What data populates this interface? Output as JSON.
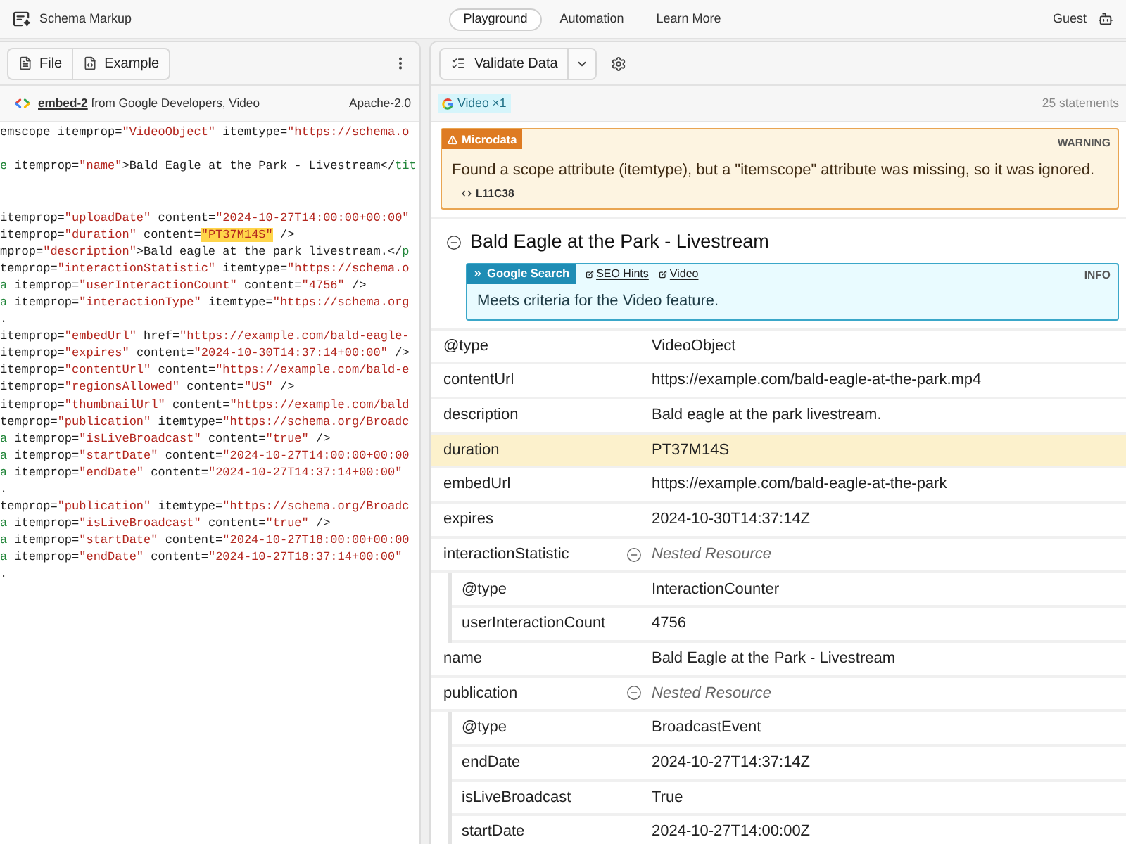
{
  "header": {
    "title": "Schema Markup",
    "nav": [
      {
        "label": "Playground",
        "selected": true
      },
      {
        "label": "Automation",
        "selected": false
      },
      {
        "label": "Learn More",
        "selected": false
      }
    ],
    "user": "Guest"
  },
  "editor": {
    "toolbar": [
      "File",
      "Example"
    ],
    "source": {
      "link": "embed-2",
      "text": "from Google Developers, Video",
      "license": "Apache-2.0"
    },
    "code": [
      {
        "kind": "code",
        "segments": [
          {
            "kind": "plain",
            "text": "emscope itemprop="
          },
          {
            "kind": "value",
            "text": "\"VideoObject\""
          },
          {
            "kind": "plain",
            "text": " itemtype="
          },
          {
            "kind": "value",
            "text": "\"https://schema.o"
          }
        ]
      },
      {
        "kind": "blank"
      },
      {
        "kind": "code",
        "segments": [
          {
            "kind": "tag",
            "text": "e"
          },
          {
            "kind": "plain",
            "text": " itemprop="
          },
          {
            "kind": "value",
            "text": "\"name\""
          },
          {
            "kind": "plain",
            "text": ">Bald Eagle at the Park - Livestream</"
          },
          {
            "kind": "tag",
            "text": "tit"
          }
        ]
      },
      {
        "kind": "blank"
      },
      {
        "kind": "blank"
      },
      {
        "kind": "code",
        "segments": [
          {
            "kind": "plain",
            "text": "itemprop="
          },
          {
            "kind": "value",
            "text": "\"uploadDate\""
          },
          {
            "kind": "plain",
            "text": " content="
          },
          {
            "kind": "value",
            "text": "\"2024-10-27T14:00:00+00:00\""
          }
        ]
      },
      {
        "kind": "code",
        "segments": [
          {
            "kind": "plain",
            "text": "itemprop="
          },
          {
            "kind": "value",
            "text": "\"duration\""
          },
          {
            "kind": "plain",
            "text": " content="
          },
          {
            "kind": "match",
            "text": "\"PT37M14S\""
          },
          {
            "kind": "plain",
            "text": " />"
          }
        ]
      },
      {
        "kind": "code",
        "segments": [
          {
            "kind": "plain",
            "text": "mprop="
          },
          {
            "kind": "value",
            "text": "\"description\""
          },
          {
            "kind": "plain",
            "text": ">Bald eagle at the park livestream.</"
          },
          {
            "kind": "tag",
            "text": "p"
          }
        ]
      },
      {
        "kind": "code",
        "segments": [
          {
            "kind": "plain",
            "text": "temprop="
          },
          {
            "kind": "value",
            "text": "\"interactionStatistic\""
          },
          {
            "kind": "plain",
            "text": " itemtype="
          },
          {
            "kind": "value",
            "text": "\"https://schema.o"
          }
        ]
      },
      {
        "kind": "code",
        "segments": [
          {
            "kind": "tag",
            "text": "a"
          },
          {
            "kind": "plain",
            "text": " itemprop="
          },
          {
            "kind": "value",
            "text": "\"userInteractionCount\""
          },
          {
            "kind": "plain",
            "text": " content="
          },
          {
            "kind": "value",
            "text": "\"4756\""
          },
          {
            "kind": "plain",
            "text": " />"
          }
        ]
      },
      {
        "kind": "code",
        "segments": [
          {
            "kind": "tag",
            "text": "a"
          },
          {
            "kind": "plain",
            "text": " itemprop="
          },
          {
            "kind": "value",
            "text": "\"interactionType\""
          },
          {
            "kind": "plain",
            "text": " itemtype="
          },
          {
            "kind": "value",
            "text": "\"https://schema.org"
          }
        ]
      },
      {
        "kind": "code",
        "segments": [
          {
            "kind": "plain",
            "text": "."
          }
        ]
      },
      {
        "kind": "code",
        "segments": [
          {
            "kind": "plain",
            "text": "itemprop="
          },
          {
            "kind": "value",
            "text": "\"embedUrl\""
          },
          {
            "kind": "plain",
            "text": " href="
          },
          {
            "kind": "value",
            "text": "\"https://example.com/bald-eagle-"
          }
        ]
      },
      {
        "kind": "code",
        "segments": [
          {
            "kind": "plain",
            "text": "itemprop="
          },
          {
            "kind": "value",
            "text": "\"expires\""
          },
          {
            "kind": "plain",
            "text": " content="
          },
          {
            "kind": "value",
            "text": "\"2024-10-30T14:37:14+00:00\""
          },
          {
            "kind": "plain",
            "text": " />"
          }
        ]
      },
      {
        "kind": "code",
        "segments": [
          {
            "kind": "plain",
            "text": "itemprop="
          },
          {
            "kind": "value",
            "text": "\"contentUrl\""
          },
          {
            "kind": "plain",
            "text": " content="
          },
          {
            "kind": "value",
            "text": "\"https://example.com/bald-e"
          }
        ]
      },
      {
        "kind": "code",
        "segments": [
          {
            "kind": "plain",
            "text": "itemprop="
          },
          {
            "kind": "value",
            "text": "\"regionsAllowed\""
          },
          {
            "kind": "plain",
            "text": " content="
          },
          {
            "kind": "value",
            "text": "\"US\""
          },
          {
            "kind": "plain",
            "text": " />"
          }
        ]
      },
      {
        "kind": "code",
        "segments": [
          {
            "kind": "plain",
            "text": "itemprop="
          },
          {
            "kind": "value",
            "text": "\"thumbnailUrl\""
          },
          {
            "kind": "plain",
            "text": " content="
          },
          {
            "kind": "value",
            "text": "\"https://example.com/bald"
          }
        ]
      },
      {
        "kind": "code",
        "segments": [
          {
            "kind": "plain",
            "text": "temprop="
          },
          {
            "kind": "value",
            "text": "\"publication\""
          },
          {
            "kind": "plain",
            "text": " itemtype="
          },
          {
            "kind": "value",
            "text": "\"https://schema.org/Broadc"
          }
        ]
      },
      {
        "kind": "code",
        "segments": [
          {
            "kind": "tag",
            "text": "a"
          },
          {
            "kind": "plain",
            "text": " itemprop="
          },
          {
            "kind": "value",
            "text": "\"isLiveBroadcast\""
          },
          {
            "kind": "plain",
            "text": " content="
          },
          {
            "kind": "value",
            "text": "\"true\""
          },
          {
            "kind": "plain",
            "text": " />"
          }
        ]
      },
      {
        "kind": "code",
        "segments": [
          {
            "kind": "tag",
            "text": "a"
          },
          {
            "kind": "plain",
            "text": " itemprop="
          },
          {
            "kind": "value",
            "text": "\"startDate\""
          },
          {
            "kind": "plain",
            "text": " content="
          },
          {
            "kind": "value",
            "text": "\"2024-10-27T14:00:00+00:00"
          }
        ]
      },
      {
        "kind": "code",
        "segments": [
          {
            "kind": "tag",
            "text": "a"
          },
          {
            "kind": "plain",
            "text": " itemprop="
          },
          {
            "kind": "value",
            "text": "\"endDate\""
          },
          {
            "kind": "plain",
            "text": " content="
          },
          {
            "kind": "value",
            "text": "\"2024-10-27T14:37:14+00:00\""
          }
        ]
      },
      {
        "kind": "code",
        "segments": [
          {
            "kind": "plain",
            "text": "."
          }
        ]
      },
      {
        "kind": "code",
        "segments": [
          {
            "kind": "plain",
            "text": "temprop="
          },
          {
            "kind": "value",
            "text": "\"publication\""
          },
          {
            "kind": "plain",
            "text": " itemtype="
          },
          {
            "kind": "value",
            "text": "\"https://schema.org/Broadc"
          }
        ]
      },
      {
        "kind": "code",
        "segments": [
          {
            "kind": "tag",
            "text": "a"
          },
          {
            "kind": "plain",
            "text": " itemprop="
          },
          {
            "kind": "value",
            "text": "\"isLiveBroadcast\""
          },
          {
            "kind": "plain",
            "text": " content="
          },
          {
            "kind": "value",
            "text": "\"true\""
          },
          {
            "kind": "plain",
            "text": " />"
          }
        ]
      },
      {
        "kind": "code",
        "segments": [
          {
            "kind": "tag",
            "text": "a"
          },
          {
            "kind": "plain",
            "text": " itemprop="
          },
          {
            "kind": "value",
            "text": "\"startDate\""
          },
          {
            "kind": "plain",
            "text": " content="
          },
          {
            "kind": "value",
            "text": "\"2024-10-27T18:00:00+00:00"
          }
        ]
      },
      {
        "kind": "code",
        "segments": [
          {
            "kind": "tag",
            "text": "a"
          },
          {
            "kind": "plain",
            "text": " itemprop="
          },
          {
            "kind": "value",
            "text": "\"endDate\""
          },
          {
            "kind": "plain",
            "text": " content="
          },
          {
            "kind": "value",
            "text": "\"2024-10-27T18:37:14+00:00\""
          }
        ]
      },
      {
        "kind": "code",
        "segments": [
          {
            "kind": "plain",
            "text": "."
          }
        ]
      }
    ]
  },
  "results": {
    "toolbar": {
      "action": "Validate Data"
    },
    "filter": {
      "label": "Video ×1"
    },
    "count": "25 statements",
    "messages": [
      {
        "kind": "warning",
        "source": "Microdata",
        "level": "WARNING",
        "text": "Found a scope attribute (itemtype), but a \"itemscope\" attribute was missing, so it was ignored.",
        "location": "L11C38"
      }
    ],
    "item": {
      "title": "Bald Eagle at the Park - Livestream",
      "expanded": true,
      "notices": [
        {
          "kind": "info",
          "source": "Google Search",
          "links": [
            "SEO Hints",
            "Video"
          ],
          "level": "INFO",
          "text": "Meets criteria for the Video feature."
        }
      ],
      "properties": [
        {
          "kind": "property",
          "name": "@type",
          "value": "VideoObject",
          "selected": false
        },
        {
          "kind": "property",
          "name": "contentUrl",
          "value": "https://example.com/bald-eagle-at-the-park.mp4",
          "selected": false
        },
        {
          "kind": "property",
          "name": "description",
          "value": "Bald eagle at the park livestream.",
          "selected": false
        },
        {
          "kind": "property",
          "name": "duration",
          "value": "PT37M14S",
          "selected": true
        },
        {
          "kind": "property",
          "name": "embedUrl",
          "value": "https://example.com/bald-eagle-at-the-park",
          "selected": false
        },
        {
          "kind": "property",
          "name": "expires",
          "value": "2024-10-30T14:37:14Z",
          "selected": false
        },
        {
          "kind": "nested",
          "name": "interactionStatistic",
          "value": "Nested Resource",
          "selected": false,
          "expanded": true,
          "children": [
            {
              "kind": "property",
              "name": "@type",
              "value": "InteractionCounter",
              "selected": false
            },
            {
              "kind": "property",
              "name": "userInteractionCount",
              "value": "4756",
              "selected": false
            }
          ]
        },
        {
          "kind": "property",
          "name": "name",
          "value": "Bald Eagle at the Park - Livestream",
          "selected": false
        },
        {
          "kind": "nested",
          "name": "publication",
          "value": "Nested Resource",
          "selected": false,
          "expanded": true,
          "children": [
            {
              "kind": "property",
              "name": "@type",
              "value": "BroadcastEvent",
              "selected": false
            },
            {
              "kind": "property",
              "name": "endDate",
              "value": "2024-10-27T14:37:14Z",
              "selected": false
            },
            {
              "kind": "property",
              "name": "isLiveBroadcast",
              "value": "True",
              "selected": false
            },
            {
              "kind": "property",
              "name": "startDate",
              "value": "2024-10-27T14:00:00Z",
              "selected": false
            }
          ]
        }
      ]
    }
  }
}
